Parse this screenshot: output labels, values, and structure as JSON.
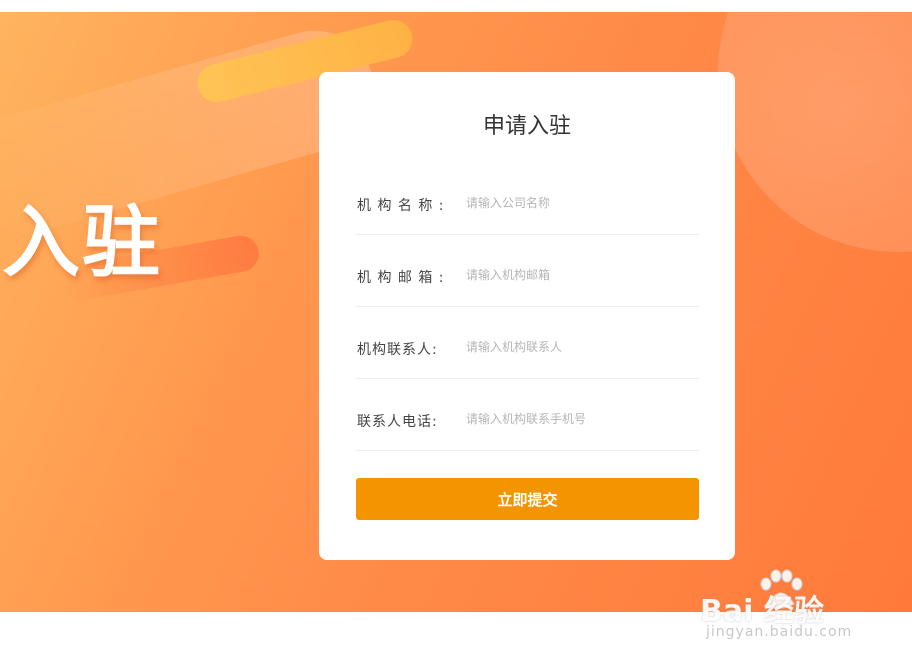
{
  "banner": {
    "hero_text": "入驻"
  },
  "form": {
    "title": "申请入驻",
    "fields": [
      {
        "label": "机 构 名 称 :",
        "placeholder": "请输入公司名称"
      },
      {
        "label": "机 构 邮 箱 :",
        "placeholder": "请输入机构邮箱"
      },
      {
        "label": "机构联系人:",
        "placeholder": "请输入机构联系人"
      },
      {
        "label": "联系人电话:",
        "placeholder": "请输入机构联系手机号"
      }
    ],
    "submit_label": "立即提交"
  },
  "watermark": {
    "brand": "Bai 经验",
    "url": "jingyan.baidu.com"
  },
  "colors": {
    "accent": "#f39400",
    "banner_start": "#ffb45e",
    "banner_end": "#ff7a3a"
  }
}
